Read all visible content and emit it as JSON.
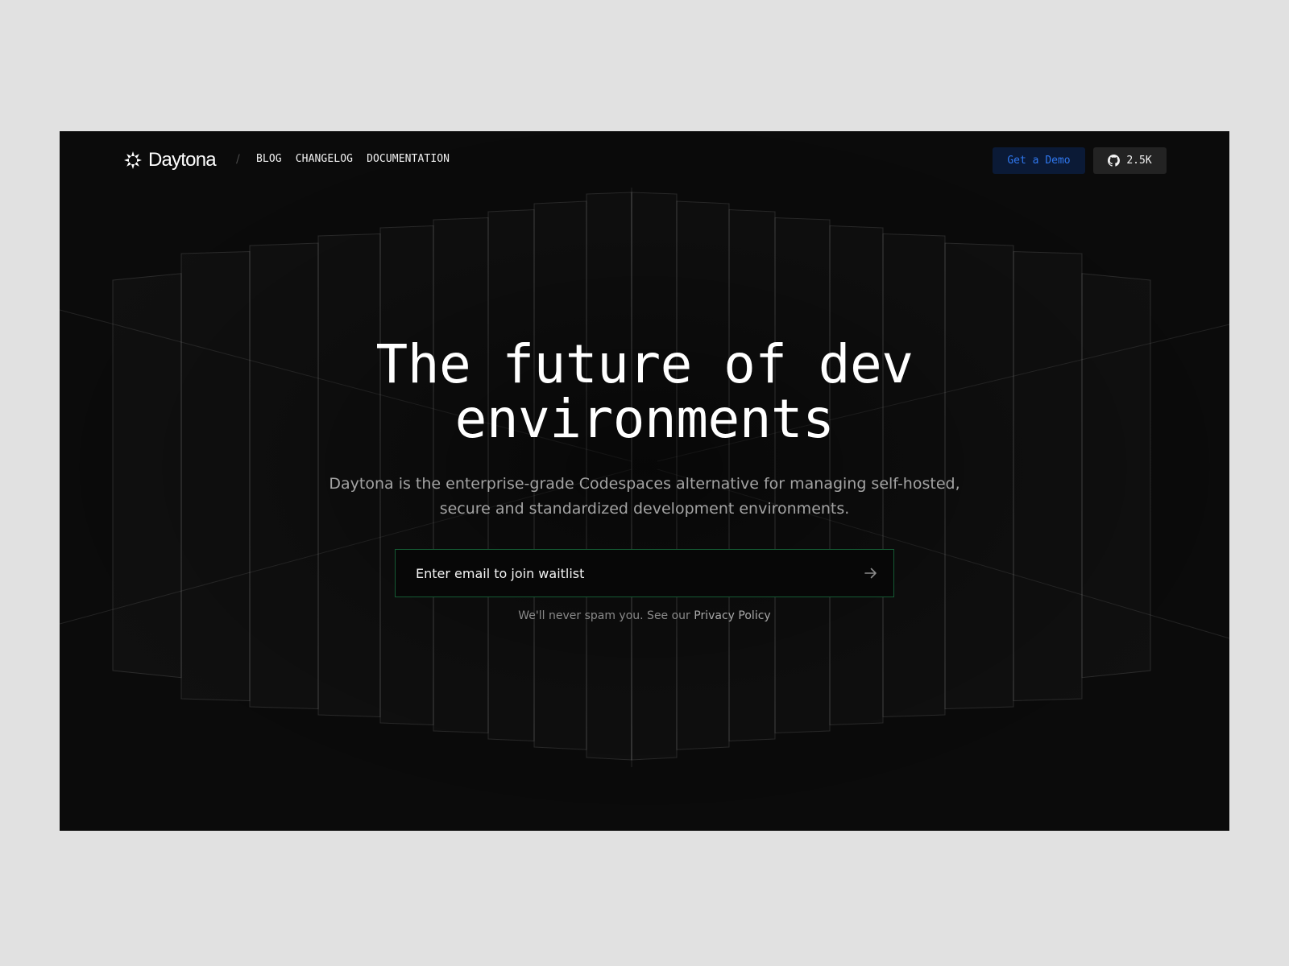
{
  "nav": {
    "brand_name": "Daytona",
    "separator": "/",
    "links": [
      {
        "label": "BLOG"
      },
      {
        "label": "CHANGELOG"
      },
      {
        "label": "DOCUMENTATION"
      }
    ],
    "demo_button_label": "Get a Demo",
    "github_stars": "2.5K"
  },
  "hero": {
    "title_line1": "The future of dev",
    "title_line2": "environments",
    "subtitle_line1": "Daytona is the enterprise-grade Codespaces alternative for managing self-hosted,",
    "subtitle_line2": "secure and standardized development environments.",
    "email_placeholder": "Enter email to join waitlist",
    "disclaimer_text": "We'll never spam you. See our",
    "privacy_link": "Privacy Policy"
  },
  "icons": {
    "brand": "daytona-logo-icon",
    "github": "github-icon",
    "submit": "arrow-right-icon"
  },
  "colors": {
    "page_background": "#e1e1e1",
    "hero_background": "#0b0b0b",
    "demo_button_bg": "#0b1a36",
    "demo_button_text": "#2f77ee",
    "github_button_bg": "#232323",
    "input_border": "#155b34",
    "subtitle_text": "#a3a3a3"
  }
}
